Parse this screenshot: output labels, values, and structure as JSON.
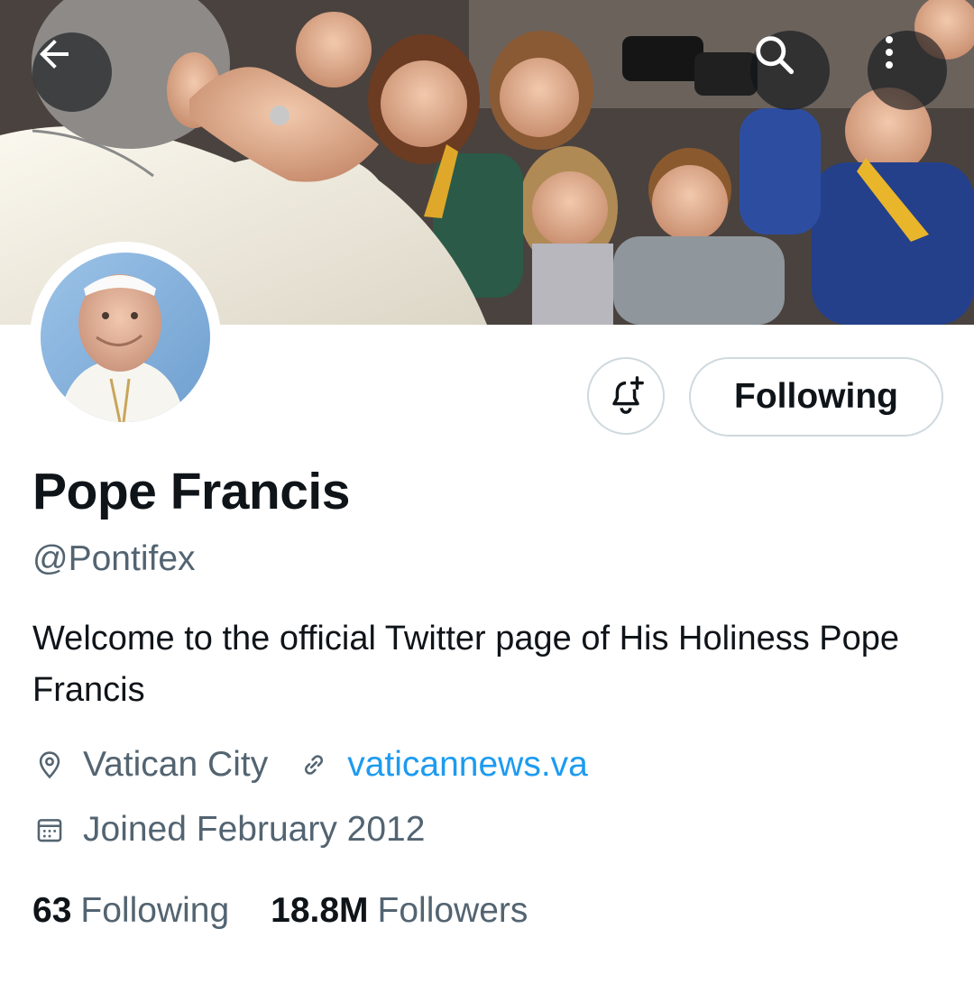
{
  "header": {
    "back_icon": "arrow-left-icon",
    "search_icon": "search-icon",
    "more_icon": "more-vertical-icon"
  },
  "profile": {
    "name": "Pope Francis",
    "handle": "@Pontifex",
    "bio": "Welcome to the official Twitter page of His Holiness Pope Francis",
    "location": "Vatican City",
    "website": "vaticannews.va",
    "joined": "Joined February 2012"
  },
  "actions": {
    "notify_icon": "bell-plus-icon",
    "following_label": "Following"
  },
  "stats": {
    "following_count": "63",
    "following_label": "Following",
    "followers_count": "18.8M",
    "followers_label": "Followers"
  },
  "colors": {
    "link": "#1d9bf0",
    "secondary_text": "#536471",
    "primary_text": "#0f1419",
    "border": "#cfd9de"
  }
}
